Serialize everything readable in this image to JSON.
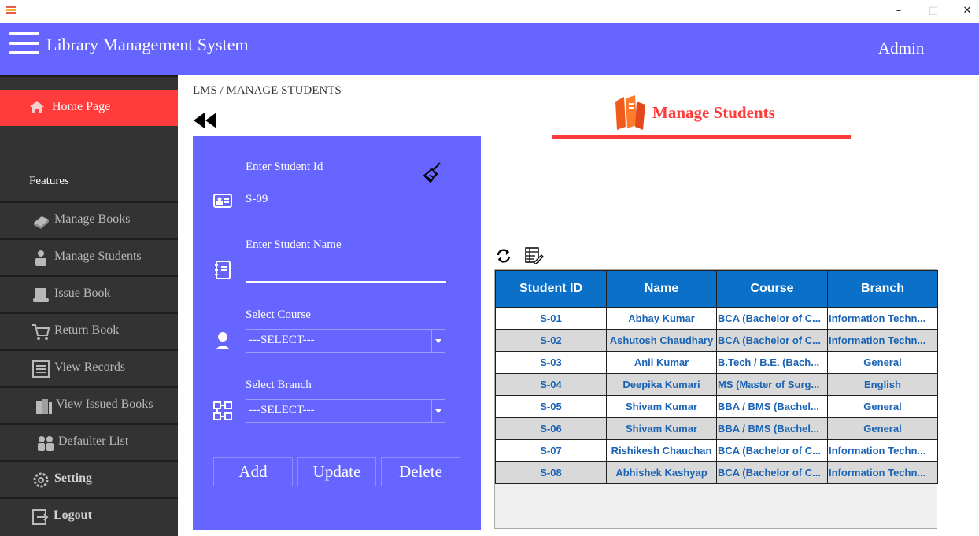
{
  "window": {
    "minimize": "–",
    "maximize": "□",
    "close": "✕"
  },
  "header": {
    "title": "Library Management System",
    "user": "Admin"
  },
  "sidebar": {
    "home": "Home Page",
    "features_label": "Features",
    "items": [
      {
        "label": "Manage Books",
        "icon": "book-icon"
      },
      {
        "label": "Manage Students",
        "icon": "student-icon"
      },
      {
        "label": "Issue Book",
        "icon": "issue-book-icon"
      },
      {
        "label": "Return Book",
        "icon": "cart-icon"
      },
      {
        "label": "View Records",
        "icon": "list-icon"
      },
      {
        "label": "View Issued Books",
        "icon": "books-icon"
      },
      {
        "label": "Defaulter List",
        "icon": "people-icon"
      },
      {
        "label": "Setting",
        "icon": "gear-icon"
      },
      {
        "label": "Logout",
        "icon": "logout-icon"
      }
    ]
  },
  "breadcrumb": "LMS / MANAGE STUDENTS",
  "page_title": "Manage Students",
  "form": {
    "student_id_label": "Enter Student Id",
    "student_id_value": "S-09",
    "student_name_label": "Enter Student Name",
    "student_name_value": "",
    "course_label": "Select Course",
    "course_value": "---SELECT---",
    "branch_label": "Select Branch",
    "branch_value": "---SELECT---",
    "add": "Add",
    "update": "Update",
    "delete": "Delete"
  },
  "table": {
    "columns": [
      "Student ID",
      "Name",
      "Course",
      "Branch"
    ],
    "rows": [
      [
        "S-01",
        "Abhay Kumar",
        "BCA (Bachelor of C...",
        "Information Techn..."
      ],
      [
        "S-02",
        "Ashutosh Chaudhary",
        "BCA (Bachelor of C...",
        "Information Techn..."
      ],
      [
        "S-03",
        "Anil Kumar",
        "B.Tech / B.E. (Bach...",
        "General"
      ],
      [
        "S-04",
        "Deepika Kumari",
        "MS (Master of Surg...",
        "English"
      ],
      [
        "S-05",
        "Shivam Kumar",
        "BBA / BMS (Bachel...",
        "General"
      ],
      [
        "S-06",
        "Shivam Kumar",
        "BBA / BMS (Bachel...",
        "General"
      ],
      [
        "S-07",
        "Rishikesh Chauchan",
        "BCA (Bachelor of C...",
        "Information Techn..."
      ],
      [
        "S-08",
        "Abhishek Kashyap",
        "BCA (Bachelor of C...",
        "Information Techn..."
      ]
    ]
  },
  "colors": {
    "accent": "#6665ff",
    "danger": "#ff3b3b",
    "sidebar": "#333333",
    "table_header": "#0a70c8",
    "table_text": "#1a63b4"
  }
}
